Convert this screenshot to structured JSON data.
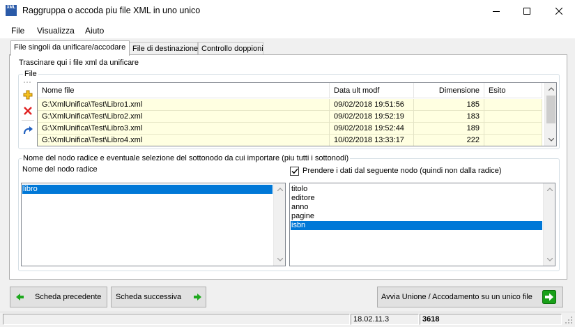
{
  "window": {
    "title": "Raggruppa o accoda piu file XML in uno unico",
    "icon_text": "XML"
  },
  "menu": [
    "File",
    "Visualizza",
    "Aiuto"
  ],
  "tabs": [
    {
      "label": "File singoli da unificare/accodare",
      "active": true
    },
    {
      "label": "File di destinazione",
      "active": false
    },
    {
      "label": "Controllo doppioni",
      "active": false
    }
  ],
  "files_section": {
    "instruction": "Trascinare qui i file xml da unificare",
    "group_label": "File",
    "columns": [
      "Nome file",
      "Data ult modf",
      "Dimensione",
      "Esito"
    ],
    "rows": [
      {
        "name": "G:\\XmlUnifica\\Test\\Libro1.xml",
        "date": "09/02/2018 19:51:56",
        "size": "185",
        "result": ""
      },
      {
        "name": "G:\\XmlUnifica\\Test\\Libro2.xml",
        "date": "09/02/2018 19:52:19",
        "size": "183",
        "result": ""
      },
      {
        "name": "G:\\XmlUnifica\\Test\\Libro3.xml",
        "date": "09/02/2018 19:52:44",
        "size": "189",
        "result": ""
      },
      {
        "name": "G:\\XmlUnifica\\Test\\Libro4.xml",
        "date": "10/02/2018 13:33:17",
        "size": "222",
        "result": ""
      }
    ]
  },
  "node_section": {
    "group_label": "Nome del nodo radice e eventuale selezione del sottonodo da cui importare (piu tutti i sottonodi)",
    "root_label": "Nome del nodo radice",
    "root_items": [
      "libro"
    ],
    "root_selected": "libro",
    "checkbox_label": "Prendere i dati dal seguente nodo (quindi non dalla radice)",
    "checkbox_checked": true,
    "sub_items": [
      "titolo",
      "editore",
      "anno",
      "pagine",
      "isbn"
    ],
    "sub_selected": "isbn"
  },
  "buttons": {
    "prev": "Scheda precedente",
    "next": "Scheda successiva",
    "run": "Avvia Unione / Accodamento su un unico file"
  },
  "status": {
    "version": "18.02.11.3",
    "count": "3618"
  },
  "colors": {
    "row_background": "#ffffe1",
    "selection": "#0078d7",
    "arrow_green": "#1ea81e"
  }
}
